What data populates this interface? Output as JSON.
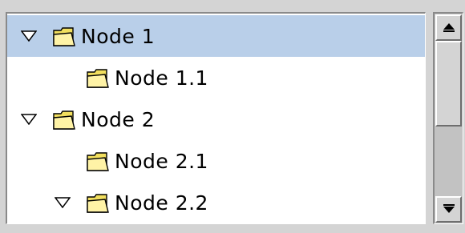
{
  "tree": {
    "nodes": [
      {
        "label": "Node 1",
        "expanded": true,
        "selected": true,
        "icon": "folder-icon"
      },
      {
        "label": "Node 1.1",
        "expanded": null,
        "selected": false,
        "icon": "folder-icon"
      },
      {
        "label": "Node 2",
        "expanded": true,
        "selected": false,
        "icon": "folder-icon"
      },
      {
        "label": "Node 2.1",
        "expanded": null,
        "selected": false,
        "icon": "folder-icon"
      },
      {
        "label": "Node 2.2",
        "expanded": true,
        "selected": false,
        "icon": "folder-icon"
      }
    ]
  },
  "colors": {
    "selection": "#b9cfe9",
    "folder_fill": "#f2df5e",
    "folder_dark": "#b89a1e"
  },
  "scrollbar": {
    "up_icon": "arrow-up-icon",
    "down_icon": "arrow-down-icon"
  }
}
